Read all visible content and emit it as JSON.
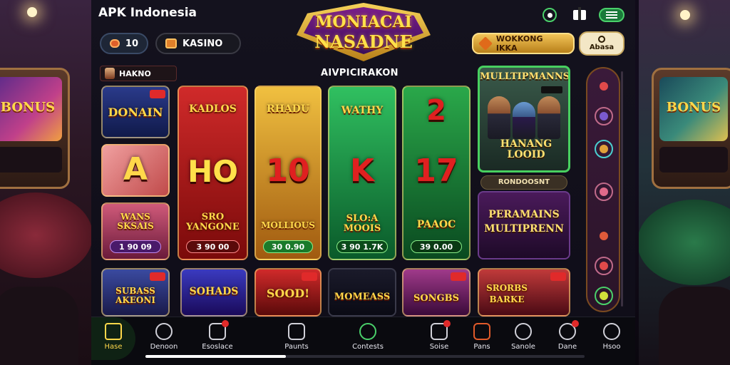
{
  "header": {
    "brand": "APK Indonesia",
    "logo_line1": "MONIACAI",
    "logo_line2": "NASADNE",
    "coins_value": "10",
    "kasino_label": "KASINO",
    "promo_label": "WOKKONG IKKA",
    "round_label": "Abasa"
  },
  "category": {
    "chip_label": "HAKNO",
    "section_title": "AIVPICIRAKON"
  },
  "games": [
    {
      "title": "DONAIN",
      "accent": "#1e3a8a"
    },
    {
      "title": "KADLOS",
      "accent": "#b81a1a"
    },
    {
      "title": "RHADU",
      "accent": "#c87a1a"
    },
    {
      "title": "WATHY",
      "accent": "#18a04a"
    },
    {
      "big": "2",
      "accent": "#18a04a"
    },
    {
      "big": "A",
      "accent": "#e06a6a"
    },
    {
      "big": "HO",
      "accent": "#b81a1a"
    },
    {
      "big": "10",
      "accent": "#c87a1a"
    },
    {
      "big": "K",
      "accent": "#18a04a"
    },
    {
      "big": "17",
      "accent": "#18a04a"
    },
    {
      "title": "WANS SKSAIS",
      "price": "1 90 09",
      "accent": "#8a1a4a"
    },
    {
      "title": "SRO YANGONE",
      "price": "3 90 00",
      "accent": "#a01818"
    },
    {
      "title": "MOLLIOUS",
      "price": "30 0.90",
      "accent": "#c87a1a"
    },
    {
      "title": "SLO:A MOOIS",
      "price": "3 90 1.7K",
      "accent": "#18a04a"
    },
    {
      "title": "PAAOC",
      "price": "39 0.00",
      "accent": "#18a04a"
    },
    {
      "title": "SUBASS AKEONI",
      "accent": "#1e3a8a"
    },
    {
      "title": "SOHADS",
      "accent": "#3a1a8a"
    },
    {
      "title": "SOOD!",
      "accent": "#b81a1a"
    },
    {
      "title": "MOMEASS",
      "accent": "#1a1a2a"
    },
    {
      "title": "SONGBS",
      "accent": "#7a1a7a"
    }
  ],
  "promo": {
    "top_title": "MULLTIPMANNS",
    "top_bottom": "HANANG LOOID",
    "sub_banner": "RONDOOSNT",
    "bottom_title_1": "PERAMAINS",
    "bottom_title_2": "MULTIPRENN",
    "corner_title_1": "SRORBS",
    "corner_title_2": "BARKE"
  },
  "bottom_nav": [
    {
      "label": "Hase",
      "icon": "home-icon"
    },
    {
      "label": "Denoon",
      "icon": "clock-icon"
    },
    {
      "label": "Esoslace",
      "icon": "chart-icon"
    },
    {
      "label": "Paunts",
      "icon": "cart-icon"
    },
    {
      "label": "Contests",
      "icon": "check-icon"
    },
    {
      "label": "Soise",
      "icon": "stats-icon"
    },
    {
      "label": "Pans",
      "icon": "chat-icon"
    },
    {
      "label": "Sanole",
      "icon": "timer-icon"
    },
    {
      "label": "Dane",
      "icon": "search-icon"
    },
    {
      "label": "Hsoo",
      "icon": "face-icon"
    }
  ],
  "scroll_progress": 0.32,
  "colors": {
    "accent_green": "#4ad06a",
    "gold": "#ffd84a",
    "panel_bg": "#14121e"
  }
}
